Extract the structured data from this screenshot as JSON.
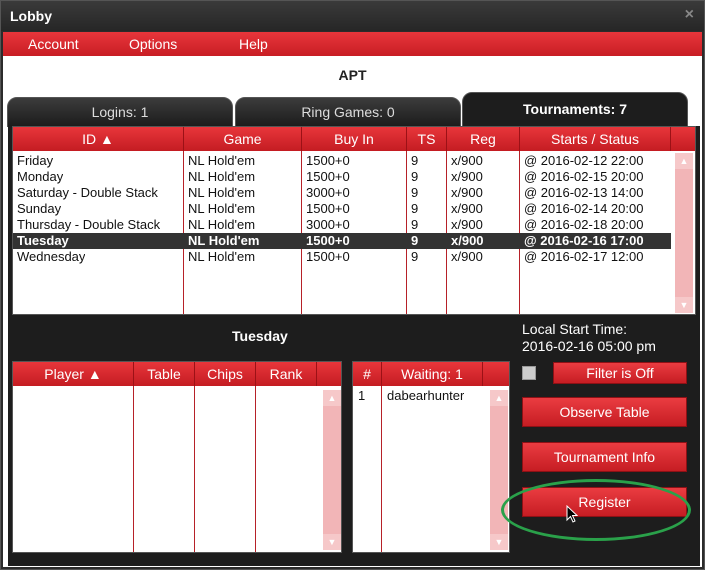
{
  "window": {
    "title": "Lobby",
    "close_icon": "×"
  },
  "menu": {
    "items": [
      "Account",
      "Options",
      "Help"
    ]
  },
  "heading": "APT",
  "tabs": [
    {
      "label": "Logins: 1"
    },
    {
      "label": "Ring Games: 0"
    },
    {
      "label": "Tournaments: 7"
    }
  ],
  "tournaments": {
    "columns": [
      "ID ▲",
      "Game",
      "Buy In",
      "TS",
      "Reg",
      "Starts / Status"
    ],
    "rows": [
      {
        "id": "Friday",
        "game": "NL Hold'em",
        "buyin": "1500+0",
        "ts": "9",
        "reg": "x/900",
        "status": "@ 2016-02-12 22:00"
      },
      {
        "id": "Monday",
        "game": "NL Hold'em",
        "buyin": "1500+0",
        "ts": "9",
        "reg": "x/900",
        "status": "@ 2016-02-15 20:00"
      },
      {
        "id": "Saturday - Double Stack",
        "game": "NL Hold'em",
        "buyin": "3000+0",
        "ts": "9",
        "reg": "x/900",
        "status": "@ 2016-02-13 14:00"
      },
      {
        "id": "Sunday",
        "game": "NL Hold'em",
        "buyin": "1500+0",
        "ts": "9",
        "reg": "x/900",
        "status": "@ 2016-02-14 20:00"
      },
      {
        "id": "Thursday - Double Stack",
        "game": "NL Hold'em",
        "buyin": "3000+0",
        "ts": "9",
        "reg": "x/900",
        "status": "@ 2016-02-18 20:00"
      },
      {
        "id": "Tuesday",
        "game": "NL Hold'em",
        "buyin": "1500+0",
        "ts": "9",
        "reg": "x/900",
        "status": "@ 2016-02-16 17:00"
      },
      {
        "id": "Wednesday",
        "game": "NL Hold'em",
        "buyin": "1500+0",
        "ts": "9",
        "reg": "x/900",
        "status": "@ 2016-02-17 12:00"
      }
    ],
    "selected_index": 5
  },
  "selected_tournament": "Tuesday",
  "players": {
    "columns": [
      "Player ▲",
      "Table",
      "Chips",
      "Rank"
    ]
  },
  "waiting": {
    "columns": [
      "#",
      "Waiting: 1"
    ],
    "rows": [
      {
        "num": "1",
        "name": "dabearhunter"
      }
    ]
  },
  "start_time": {
    "label": "Local Start Time:",
    "value": "2016-02-16 05:00 pm"
  },
  "buttons": {
    "filter": "Filter is Off",
    "observe": "Observe Table",
    "info": "Tournament Info",
    "register": "Register"
  },
  "colors": {
    "accent_red": "#d42a30",
    "panel_dark": "#1d1d1d",
    "highlight_green": "#2aa14a"
  }
}
